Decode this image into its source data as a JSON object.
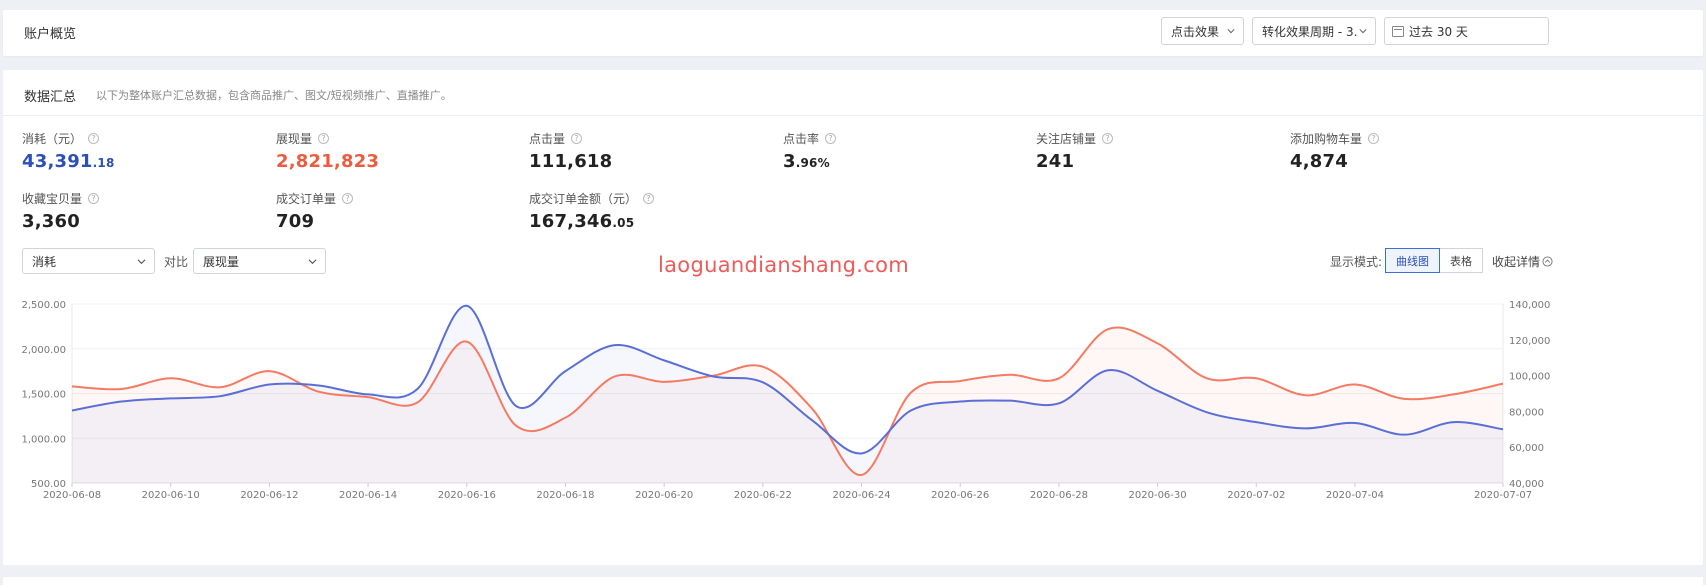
{
  "header": {
    "title": "账户概览",
    "filters": [
      {
        "value": "点击效果"
      },
      {
        "value": "转化效果周期 - 3..."
      },
      {
        "value": "过去 30 天"
      }
    ]
  },
  "summary": {
    "title": "数据汇总",
    "desc": "以下为整体账户汇总数据，包含商品推广、图文/短视频推广、直播推广。",
    "metrics": [
      {
        "label": "消耗（元）",
        "int": "43,391",
        "dec": ".18",
        "color": "#2d50b6"
      },
      {
        "label": "展现量",
        "int": "2,821,823",
        "dec": "",
        "color": "#ee5c3f"
      },
      {
        "label": "点击量",
        "int": "111,618",
        "dec": ""
      },
      {
        "label": "点击率",
        "int": "3",
        "dec": ".96%"
      },
      {
        "label": "关注店铺量",
        "int": "241",
        "dec": ""
      },
      {
        "label": "添加购物车量",
        "int": "4,874",
        "dec": ""
      },
      {
        "label": "收藏宝贝量",
        "int": "3,360",
        "dec": ""
      },
      {
        "label": "成交订单量",
        "int": "709",
        "dec": ""
      },
      {
        "label": "成交订单金额（元）",
        "int": "167,346",
        "dec": ".05"
      }
    ]
  },
  "controls": {
    "metric_a": "消耗",
    "vs_label": "对比",
    "metric_b": "展现量",
    "watermark": "laoguandianshang.com",
    "mode_label": "显示模式:",
    "mode_curve": "曲线图",
    "mode_table": "表格",
    "collapse": "收起详情"
  },
  "chart_data": {
    "type": "line",
    "x": [
      "2020-06-08",
      "2020-06-09",
      "2020-06-10",
      "2020-06-11",
      "2020-06-12",
      "2020-06-13",
      "2020-06-14",
      "2020-06-15",
      "2020-06-16",
      "2020-06-17",
      "2020-06-18",
      "2020-06-19",
      "2020-06-20",
      "2020-06-21",
      "2020-06-22",
      "2020-06-23",
      "2020-06-24",
      "2020-06-25",
      "2020-06-26",
      "2020-06-27",
      "2020-06-28",
      "2020-06-29",
      "2020-06-30",
      "2020-07-01",
      "2020-07-02",
      "2020-07-03",
      "2020-07-04",
      "2020-07-05",
      "2020-07-06",
      "2020-07-07"
    ],
    "x_tick_labels": [
      "2020-06-08",
      "2020-06-10",
      "2020-06-12",
      "2020-06-14",
      "2020-06-16",
      "2020-06-18",
      "2020-06-20",
      "2020-06-22",
      "2020-06-24",
      "2020-06-26",
      "2020-06-28",
      "2020-06-30",
      "2020-07-02",
      "2020-07-04",
      "2020-07-07"
    ],
    "y_left": {
      "min": 500,
      "max": 2500,
      "ticks": [
        "500.00",
        "1,000.00",
        "1,500.00",
        "2,000.00",
        "2,500.00"
      ]
    },
    "y_right": {
      "min": 40000,
      "max": 140000,
      "ticks": [
        "40,000",
        "60,000",
        "80,000",
        "100,000",
        "120,000",
        "140,000"
      ]
    },
    "series": [
      {
        "name": "消耗",
        "axis": "left",
        "color": "#5a6fd6",
        "values": [
          1310,
          1410,
          1445,
          1470,
          1600,
          1590,
          1490,
          1550,
          2480,
          1360,
          1750,
          2040,
          1870,
          1690,
          1625,
          1200,
          830,
          1310,
          1410,
          1420,
          1390,
          1760,
          1530,
          1290,
          1180,
          1110,
          1170,
          1040,
          1180,
          1100
        ]
      },
      {
        "name": "展现量",
        "axis": "right",
        "color": "#f57a62",
        "values": [
          94000,
          92500,
          98500,
          93500,
          102500,
          91000,
          88000,
          85000,
          119000,
          72000,
          76500,
          99500,
          96500,
          100000,
          105000,
          81500,
          44500,
          90500,
          97000,
          100500,
          98500,
          126000,
          118000,
          98500,
          98500,
          89000,
          95000,
          87000,
          89500,
          95500
        ]
      }
    ]
  }
}
